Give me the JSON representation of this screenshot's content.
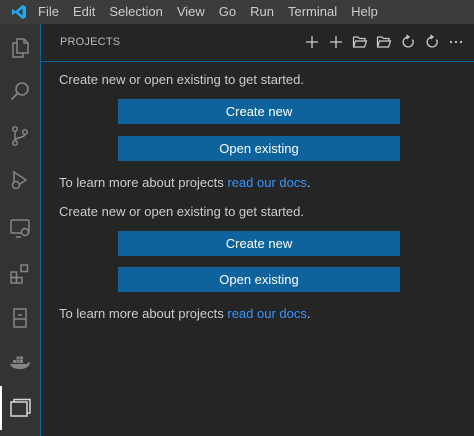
{
  "app": {
    "logo_icon": "vscode-logo",
    "accent": "#0e639c",
    "link_color": "#3794ff"
  },
  "menu": [
    "File",
    "Edit",
    "Selection",
    "View",
    "Go",
    "Run",
    "Terminal",
    "Help"
  ],
  "activity_bar": [
    {
      "icon": "files-icon"
    },
    {
      "icon": "search-icon"
    },
    {
      "icon": "source-control-icon"
    },
    {
      "icon": "run-debug-icon"
    },
    {
      "icon": "remote-explorer-icon"
    },
    {
      "icon": "extensions-icon"
    },
    {
      "icon": "package-icon"
    },
    {
      "icon": "docker-icon"
    },
    {
      "icon": "project-manager-icon",
      "active": true
    }
  ],
  "sidebar": {
    "title": "PROJECTS",
    "actions": [
      {
        "icon": "add-icon"
      },
      {
        "icon": "add-icon"
      },
      {
        "icon": "folder-open-icon"
      },
      {
        "icon": "folder-open-icon"
      },
      {
        "icon": "refresh-icon"
      },
      {
        "icon": "refresh-icon"
      },
      {
        "icon": "more-icon"
      }
    ],
    "sections": [
      {
        "intro": "Create new or open existing to get started.",
        "create_label": "Create new",
        "open_label": "Open existing",
        "learn_prefix": "To learn more about projects ",
        "learn_link": "read our docs",
        "learn_suffix": "."
      },
      {
        "intro": "Create new or open existing to get started.",
        "create_label": "Create new",
        "open_label": "Open existing",
        "learn_prefix": "To learn more about projects ",
        "learn_link": "read our docs",
        "learn_suffix": "."
      }
    ]
  }
}
